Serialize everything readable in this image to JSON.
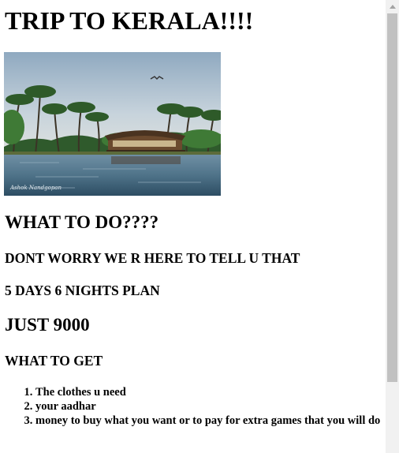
{
  "page": {
    "title": "TRIP TO KERALA!!!!",
    "hero_image": {
      "alt": "",
      "signature": "Ashok Nandgopan"
    },
    "sections": {
      "what_to_do": "WHAT TO DO????",
      "dont_worry": "DONT WORRY WE R HERE TO TELL U THAT",
      "plan": "5 DAYS 6 NIGHTS PLAN",
      "price": "JUST 9000",
      "what_to_get": "WHAT TO GET"
    },
    "checklist": [
      "The clothes u need",
      "your aadhar",
      "money to buy what you want or to pay for extra games that you will do"
    ]
  },
  "scrollbar": {
    "icon": "scroll-up-arrow-icon"
  },
  "colors": {
    "text": "#000000",
    "background": "#ffffff",
    "scroll_track": "#f1f1f1",
    "scroll_thumb": "#c1c1c1"
  }
}
